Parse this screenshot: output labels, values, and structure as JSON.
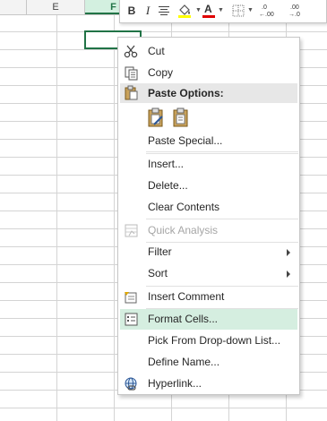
{
  "sheet": {
    "columns": [
      "E",
      "F"
    ],
    "selected_column": "F"
  },
  "colors": {
    "accent": "#217346",
    "highlight": "#d5eee0",
    "font_color_bar": "#e00000",
    "fill_color_bar": "#ffff00"
  },
  "toolbar": {
    "bold": "B",
    "italic": "I",
    "font_color": "A",
    "increase_decimal": ".0\n←.00",
    "decrease_decimal": ".00\n→.0"
  },
  "menu": {
    "cut": "Cut",
    "copy": "Copy",
    "paste_options": "Paste Options:",
    "paste_special": "Paste Special...",
    "insert": "Insert...",
    "delete": "Delete...",
    "clear_contents": "Clear Contents",
    "quick_analysis": "Quick Analysis",
    "filter": "Filter",
    "sort": "Sort",
    "insert_comment": "Insert Comment",
    "format_cells": "Format Cells...",
    "pick_from_list": "Pick From Drop-down List...",
    "define_name": "Define Name...",
    "hyperlink": "Hyperlink..."
  },
  "icons": [
    "scissors-icon",
    "copy-icon",
    "paste-icon",
    "paste-icon",
    "paste-values-icon",
    "quick-analysis-icon",
    "comment-icon",
    "format-cells-icon",
    "hyperlink-icon"
  ]
}
